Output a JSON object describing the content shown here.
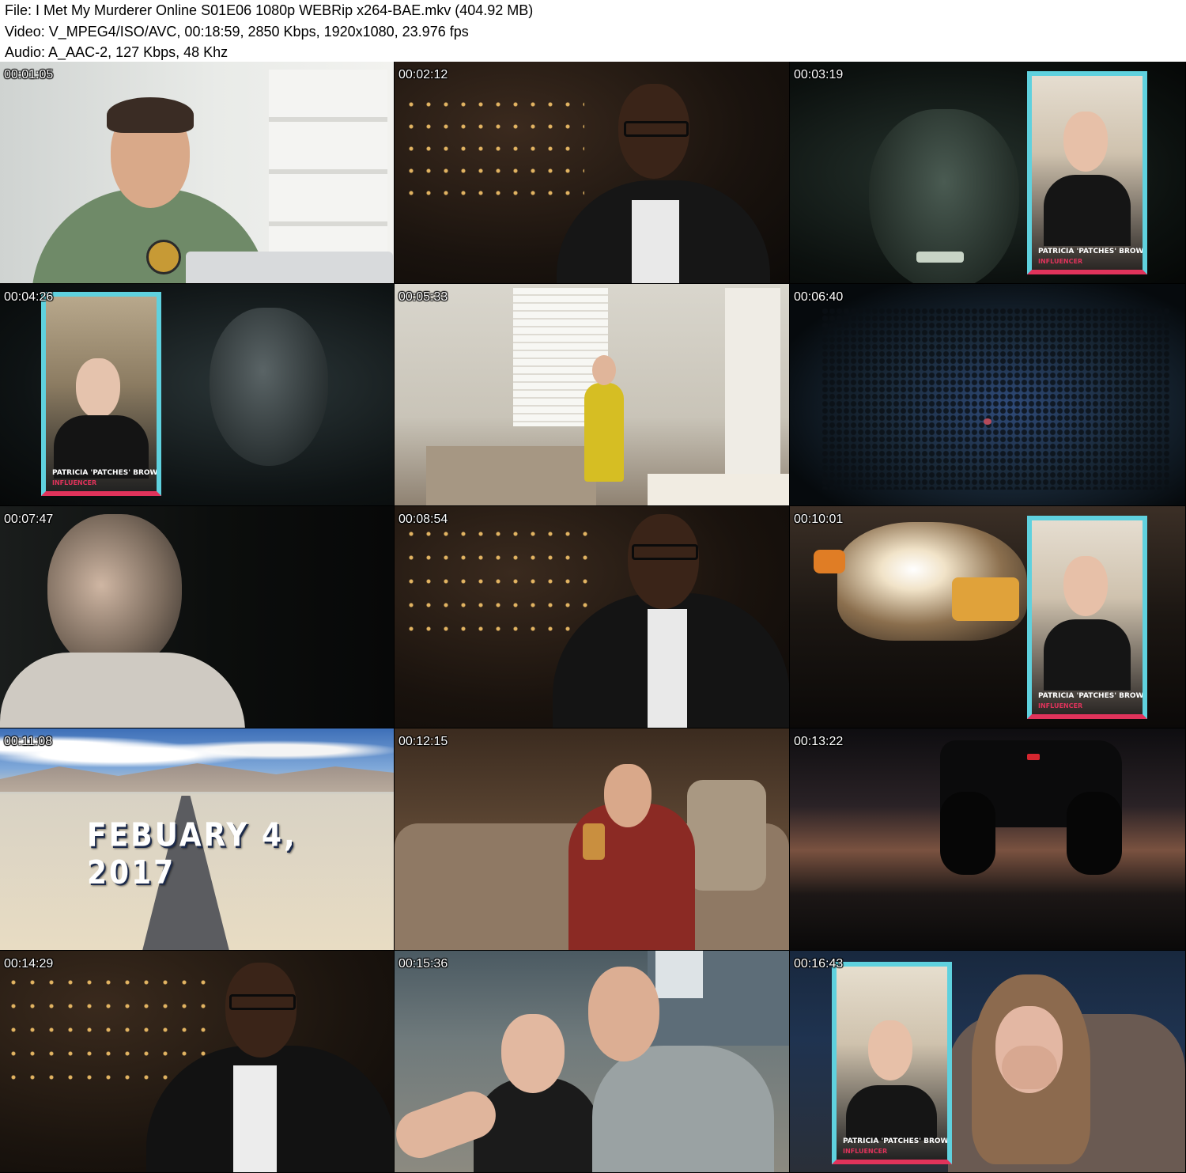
{
  "header": {
    "file_line": "File: I Met My Murderer Online S01E06 1080p WEBRip x264-BAE.mkv (404.92 MB)",
    "video_line": "Video: V_MPEG4/ISO/AVC, 00:18:59, 2850 Kbps, 1920x1080, 23.976 fps",
    "audio_line": "Audio: A_AAC-2, 127 Kbps, 48 Khz"
  },
  "overlay": {
    "card_name": "PATRICIA 'PATCHES' BROWN",
    "card_role": "INFLUENCER",
    "date_title": "FEBUARY 4, 2017"
  },
  "thumbnails": [
    {
      "timestamp": "00:01:05"
    },
    {
      "timestamp": "00:02:12"
    },
    {
      "timestamp": "00:03:19"
    },
    {
      "timestamp": "00:04:26"
    },
    {
      "timestamp": "00:05:33"
    },
    {
      "timestamp": "00:06:40"
    },
    {
      "timestamp": "00:07:47"
    },
    {
      "timestamp": "00:08:54"
    },
    {
      "timestamp": "00:10:01"
    },
    {
      "timestamp": "00:11:08"
    },
    {
      "timestamp": "00:12:15"
    },
    {
      "timestamp": "00:13:22"
    },
    {
      "timestamp": "00:14:29"
    },
    {
      "timestamp": "00:15:36"
    },
    {
      "timestamp": "00:16:43"
    }
  ],
  "colors": {
    "card_border_top": "#5fd1de",
    "card_border_bottom": "#e0335b",
    "background": "#ffffff"
  }
}
